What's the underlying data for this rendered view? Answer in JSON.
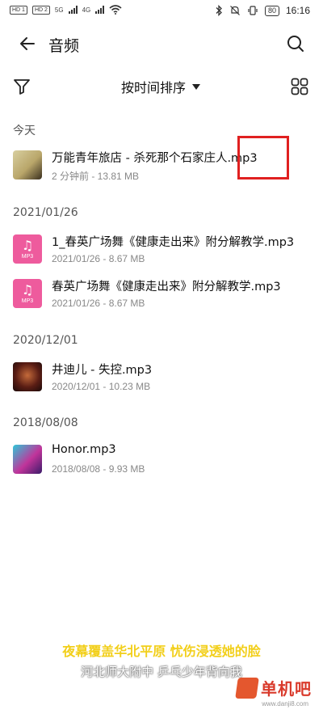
{
  "status_bar": {
    "sim1": "HD 1",
    "sim2": "HD 2",
    "net1": "5G",
    "net2": "4G",
    "battery": "80",
    "time": "16:16"
  },
  "header": {
    "title": "音频"
  },
  "toolbar": {
    "sort_label": "按时间排序"
  },
  "sections": [
    {
      "header": "今天",
      "items": [
        {
          "title": "万能青年旅店 - 杀死那个石家庄人.mp3",
          "meta": "2 分钟前 - 13.81 MB",
          "thumb": "album-art"
        }
      ]
    },
    {
      "header": "2021/01/26",
      "items": [
        {
          "title": "1_春英广场舞《健康走出来》附分解教学.mp3",
          "meta": "2021/01/26 - 8.67 MB",
          "thumb": "mp3-file"
        },
        {
          "title": "春英广场舞《健康走出来》附分解教学.mp3",
          "meta": "2021/01/26 - 8.67 MB",
          "thumb": "mp3-file"
        }
      ]
    },
    {
      "header": "2020/12/01",
      "items": [
        {
          "title": "井迪儿 - 失控.mp3",
          "meta": "2020/12/01 - 10.23 MB",
          "thumb": "album-art"
        }
      ]
    },
    {
      "header": "2018/08/08",
      "items": [
        {
          "title": "Honor.mp3",
          "meta": "2018/08/08 - 9.93 MB",
          "thumb": "album-art"
        }
      ]
    }
  ],
  "mp3_thumb_label": "MP3",
  "overlay": {
    "line1": "夜幕覆盖华北平原 忧伤浸透她的脸",
    "line2": "河北师大附中 乒乓少年背向我"
  },
  "watermark": {
    "brand": "单机吧",
    "site": "www.danji8.com"
  },
  "colors": {
    "mp3_thumb": "#ee5b9d",
    "highlight": "#e02020",
    "lyric": "#f2cf1a"
  }
}
